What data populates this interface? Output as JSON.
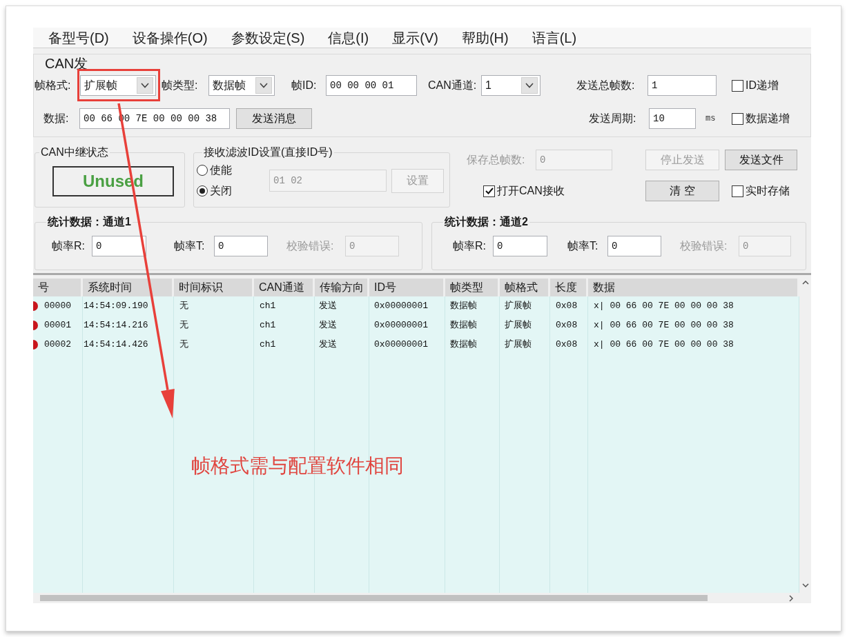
{
  "menu": [
    "备型号(D)",
    "设备操作(O)",
    "参数设定(S)",
    "信息(I)",
    "显示(V)",
    "帮助(H)",
    "语言(L)"
  ],
  "send": {
    "title": "CAN发",
    "frame_format": {
      "label": "帧格式:",
      "value": "扩展帧"
    },
    "frame_type": {
      "label": "帧类型:",
      "value": "数据帧"
    },
    "frame_id": {
      "label": "帧ID:",
      "value": "00 00 00 01"
    },
    "can_channel": {
      "label": "CAN通道:",
      "value": "1"
    },
    "total_frames": {
      "label": "发送总帧数:",
      "value": "1"
    },
    "id_increment": {
      "label": "ID递增",
      "checked": false
    },
    "data": {
      "label": "数据:",
      "value": "00 66 00 7E 00 00 00 38"
    },
    "send_button": "发送消息",
    "period": {
      "label": "发送周期:",
      "value": "10",
      "unit": "ms"
    },
    "data_increment": {
      "label": "数据递增",
      "checked": false
    }
  },
  "relay": {
    "title": "CAN中继状态",
    "status": "Unused"
  },
  "filter": {
    "title": "接收滤波ID设置(直接ID号)",
    "options": [
      {
        "label": "使能",
        "selected": false
      },
      {
        "label": "关闭",
        "selected": true
      }
    ],
    "id_value": "01 02",
    "disabled": true,
    "set_button": "设置"
  },
  "receive": {
    "saved_frames": {
      "label": "保存总帧数:",
      "value": "0",
      "disabled": true
    },
    "buttons": [
      {
        "label": "停止发送",
        "disabled": true
      },
      {
        "label": "发送文件",
        "disabled": false
      },
      {
        "label": "清 空",
        "disabled": false
      }
    ],
    "open_receive": {
      "label": "打开CAN接收",
      "checked": true
    },
    "realtime_save": {
      "label": "实时存储",
      "checked": false
    }
  },
  "stats": [
    {
      "title": "统计数据：通道1",
      "fields": [
        {
          "label": "帧率R:",
          "value": "0",
          "disabled": false
        },
        {
          "label": "帧率T:",
          "value": "0",
          "disabled": false
        },
        {
          "label": "校验错误:",
          "value": "0",
          "disabled": true
        }
      ]
    },
    {
      "title": "统计数据：通道2",
      "fields": [
        {
          "label": "帧率R:",
          "value": "0",
          "disabled": false
        },
        {
          "label": "帧率T:",
          "value": "0",
          "disabled": false
        },
        {
          "label": "校验错误:",
          "value": "0",
          "disabled": true
        }
      ]
    }
  ],
  "table": {
    "columns": [
      "号",
      "系统时间",
      "时间标识",
      "CAN通道",
      "传输方向",
      "ID号",
      "帧类型",
      "帧格式",
      "长度",
      "数据"
    ],
    "rows": [
      {
        "cells": [
          "00000",
          "14:54:09.190",
          "无",
          "ch1",
          "发送",
          "0x00000001",
          "数据帧",
          "扩展帧",
          "0x08",
          "x| 00 66 00 7E 00 00 00 38"
        ]
      },
      {
        "cells": [
          "00001",
          "14:54:14.216",
          "无",
          "ch1",
          "发送",
          "0x00000001",
          "数据帧",
          "扩展帧",
          "0x08",
          "x| 00 66 00 7E 00 00 00 38"
        ]
      },
      {
        "cells": [
          "00002",
          "14:54:14.426",
          "无",
          "ch1",
          "发送",
          "0x00000001",
          "数据帧",
          "扩展帧",
          "0x08",
          "x| 00 66 00 7E 00 00 00 38"
        ]
      }
    ]
  },
  "annotation": {
    "text": "帧格式需与配置软件相同"
  }
}
